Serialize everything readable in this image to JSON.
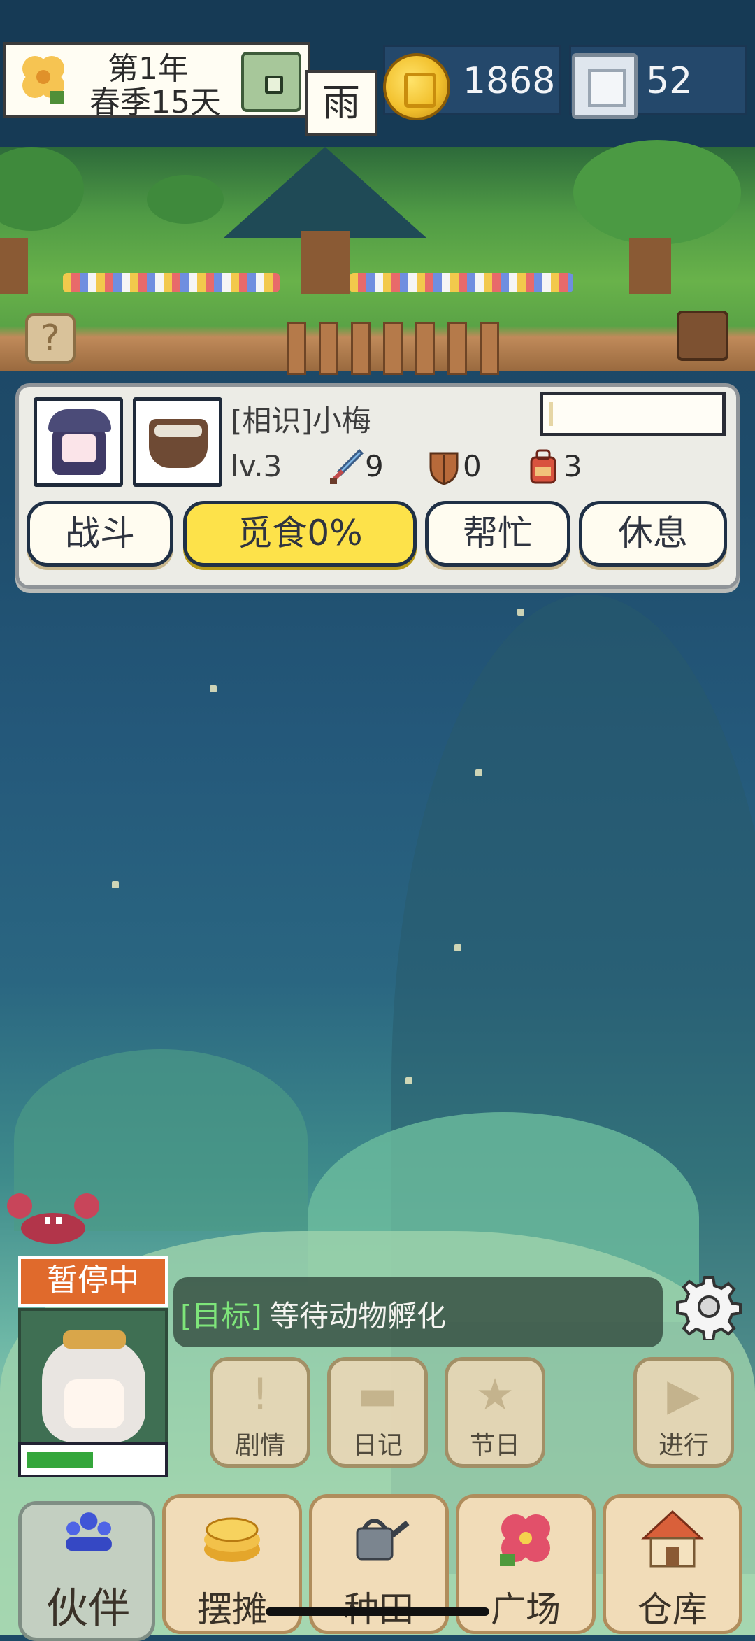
{
  "hud": {
    "date_line1": "第1年",
    "date_line2": "春季15天",
    "weather": "雨",
    "coins": "1868",
    "gems": "52",
    "help": "?"
  },
  "companion": {
    "name": "[相识]小梅",
    "level": "lv.3",
    "attack": "9",
    "defense": "0",
    "bag": "3",
    "hp_fraction": 0.02,
    "actions": {
      "fight": "战斗",
      "forage": "觅食0%",
      "help": "帮忙",
      "rest": "休息"
    }
  },
  "status": {
    "paused": "暂停中",
    "energy_fraction": 0.5
  },
  "goal": {
    "tag": "[目标]",
    "text": "等待动物孵化"
  },
  "quick_buttons": {
    "story": "剧情",
    "diary": "日记",
    "festival": "节日",
    "proceed": "进行"
  },
  "nav": {
    "partner": "伙伴",
    "stall": "摆摊",
    "farm": "种田",
    "plaza": "广场",
    "storage": "仓库"
  },
  "colors": {
    "forage_button": "#fde24a",
    "pause_badge": "#e06a2c",
    "goal_tag": "#7ee57a",
    "energy": "#34a63b"
  }
}
